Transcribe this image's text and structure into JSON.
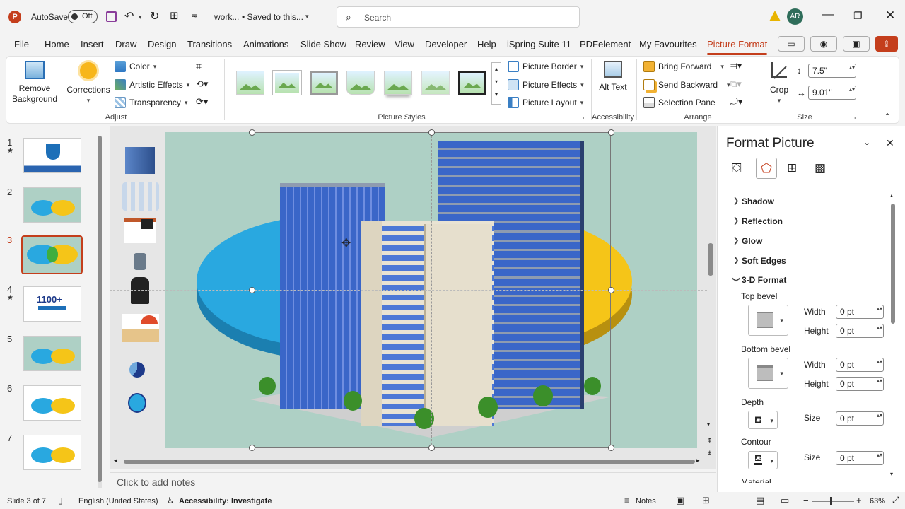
{
  "titlebar": {
    "autosave_label": "AutoSave",
    "autosave_state": "Off",
    "doc_name": "work...",
    "save_status": "• Saved to this...",
    "search_placeholder": "Search",
    "avatar_initials": "AR",
    "warning_icon": "warning-icon"
  },
  "menu": {
    "tabs": [
      "File",
      "Home",
      "Insert",
      "Draw",
      "Design",
      "Transitions",
      "Animations",
      "Slide Show",
      "Review",
      "View",
      "Developer",
      "Help",
      "iSpring Suite 11",
      "PDFelement",
      "My Favourites",
      "Picture Format"
    ],
    "active": "Picture Format"
  },
  "ribbon": {
    "adjust": {
      "group_label": "Adjust",
      "remove_bg": "Remove Background",
      "corrections": "Corrections",
      "color": "Color",
      "artistic": "Artistic Effects",
      "transparency": "Transparency"
    },
    "styles": {
      "group_label": "Picture Styles",
      "border": "Picture Border",
      "effects": "Picture Effects",
      "layout": "Picture Layout"
    },
    "accessibility": {
      "group_label": "Accessibility",
      "alt_text": "Alt Text"
    },
    "arrange": {
      "group_label": "Arrange",
      "bring_forward": "Bring Forward",
      "send_backward": "Send Backward",
      "selection_pane": "Selection Pane"
    },
    "size": {
      "group_label": "Size",
      "crop": "Crop",
      "height": "7.5\"",
      "width": "9.01\""
    }
  },
  "slides": {
    "numbers": [
      "1",
      "2",
      "3",
      "4",
      "5",
      "6",
      "7"
    ],
    "selected": 3,
    "thumb4_text": "1100+"
  },
  "notes_placeholder": "Click to add notes",
  "format_pane": {
    "title": "Format Picture",
    "sections": [
      "Shadow",
      "Reflection",
      "Glow",
      "Soft Edges",
      "3-D Format"
    ],
    "top_bevel": "Top bevel",
    "bottom_bevel": "Bottom bevel",
    "depth": "Depth",
    "contour": "Contour",
    "material": "Material",
    "width_label": "Width",
    "height_label": "Height",
    "size_label": "Size",
    "values": {
      "top_width": "0 pt",
      "top_height": "0 pt",
      "bottom_width": "0 pt",
      "bottom_height": "0 pt",
      "depth_size": "0 pt",
      "contour_size": "0 pt"
    }
  },
  "status": {
    "slide_info": "Slide 3 of 7",
    "language": "English (United States)",
    "accessibility": "Accessibility: Investigate",
    "notes": "Notes",
    "zoom": "63%"
  },
  "colors": {
    "accent": "#c43e1c",
    "slide_bg": "#aed0c5",
    "blue_oval": "#29a8e0",
    "yellow_oval": "#f5c518"
  }
}
